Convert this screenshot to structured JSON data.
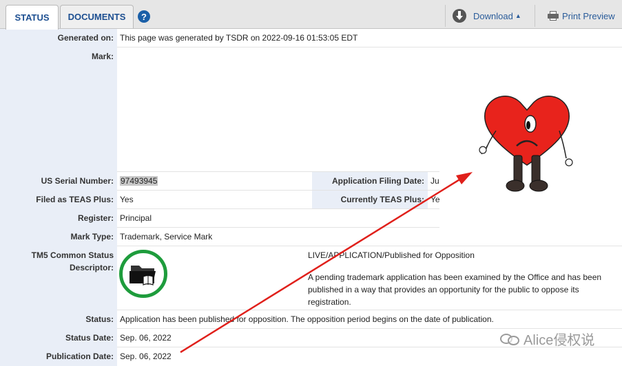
{
  "tabs": {
    "status": "STATUS",
    "documents": "DOCUMENTS",
    "help": "?"
  },
  "toolbar": {
    "download": "Download",
    "print": "Print Preview"
  },
  "fields": {
    "generated_label": "Generated on:",
    "generated_value": "This page was generated by TSDR on 2022-09-16 01:53:05 EDT",
    "mark_label": "Mark:",
    "serial_label": "US Serial Number:",
    "serial_value": "97493945",
    "filing_label": "Application Filing Date:",
    "filing_value": "Ju",
    "teas_label": "Filed as TEAS Plus:",
    "teas_value": "Yes",
    "cur_teas_label": "Currently TEAS Plus:",
    "cur_teas_value": "Ye",
    "register_label": "Register:",
    "register_value": "Principal",
    "marktype_label": "Mark Type:",
    "marktype_value": "Trademark, Service Mark",
    "tm5_label_1": "TM5 Common Status",
    "tm5_label_2": "Descriptor:",
    "tm5_title": "LIVE/APPLICATION/Published for Opposition",
    "tm5_desc": "A pending trademark application has been examined by the Office and has been published in a way that provides an opportunity for the public to oppose its registration.",
    "status_label": "Status:",
    "status_value": "Application has been published for opposition. The opposition period begins on the date of publication.",
    "status_date_label": "Status Date:",
    "status_date_value": "Sep. 06, 2022",
    "pub_date_label": "Publication Date:",
    "pub_date_value": "Sep. 06, 2022"
  },
  "watermark": "Alice侵权说",
  "colors": {
    "accent": "#1d4f91",
    "label_bg": "#e9eef7",
    "tm5_green": "#1e9c3c",
    "arrow": "#e0201b",
    "heart": "#e8231c"
  }
}
